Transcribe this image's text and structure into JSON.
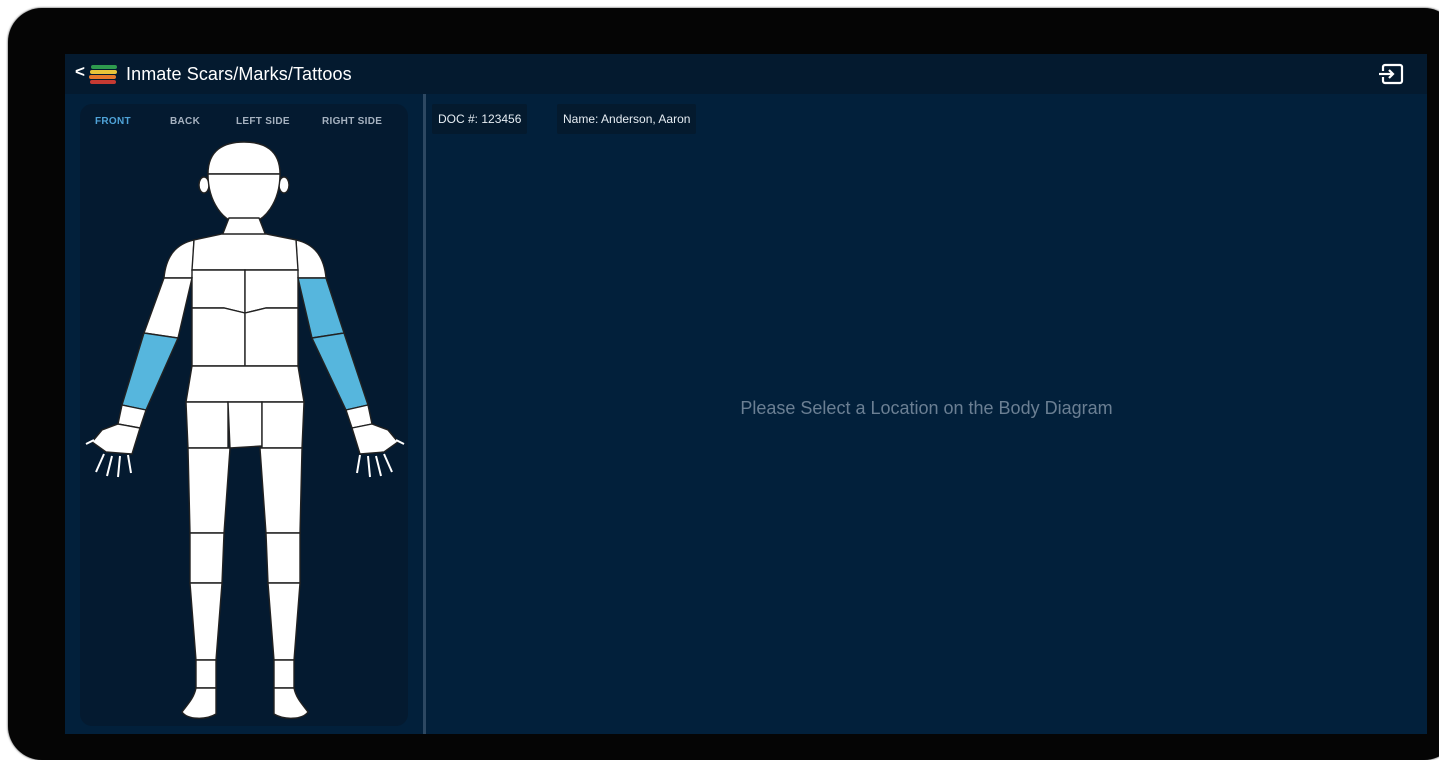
{
  "header": {
    "back_symbol": "<",
    "title": "Inmate Scars/Marks/Tattoos",
    "logo_icon": "stacked-stripes-logo",
    "exit_icon": "sign-out-icon"
  },
  "body_view_tabs": [
    {
      "label": "FRONT",
      "active": true
    },
    {
      "label": "BACK",
      "active": false
    },
    {
      "label": "LEFT SIDE",
      "active": false
    },
    {
      "label": "RIGHT SIDE",
      "active": false
    }
  ],
  "inmate": {
    "doc_number": "DOC #: 123456",
    "name": "Name: Anderson, Aaron"
  },
  "body_diagram": {
    "view": "FRONT",
    "highlighted_regions": [
      "right-forearm",
      "left-upper-arm",
      "left-forearm"
    ]
  },
  "main": {
    "placeholder": "Please Select a Location on the Body Diagram"
  },
  "colors": {
    "screen_bg": "#02203b",
    "panel_bg": "#041a30",
    "accent": "#4fa3d8",
    "highlight": "#56b6dd",
    "muted_text": "#6b7f93"
  }
}
